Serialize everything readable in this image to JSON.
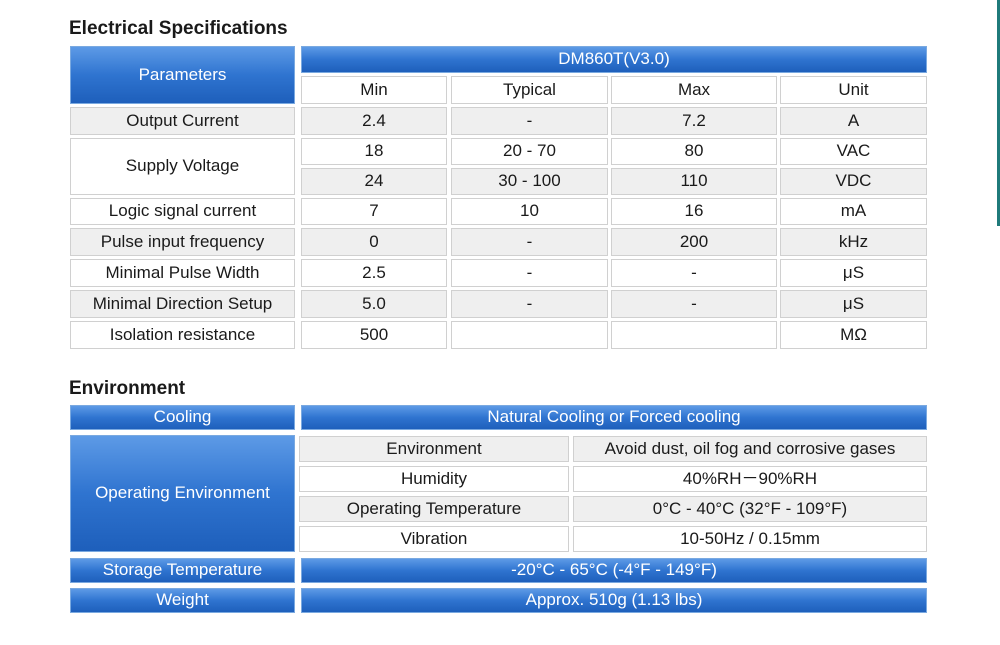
{
  "electrical": {
    "title": "Electrical Specifications",
    "param_header": "Parameters",
    "model": "DM860T(V3.0)",
    "columns": [
      "Min",
      "Typical",
      "Max",
      "Unit"
    ],
    "rows": [
      {
        "label": "Output Current",
        "min": "2.4",
        "typ": "-",
        "max": "7.2",
        "unit": "A"
      },
      {
        "label": "Supply Voltage",
        "min": "18",
        "typ": "20 - 70",
        "max": "80",
        "unit": "VAC"
      },
      {
        "label": "",
        "min": "24",
        "typ": "30 - 100",
        "max": "110",
        "unit": "VDC"
      },
      {
        "label": "Logic signal current",
        "min": "7",
        "typ": "10",
        "max": "16",
        "unit": "mA"
      },
      {
        "label": "Pulse input frequency",
        "min": "0",
        "typ": "-",
        "max": "200",
        "unit": "kHz"
      },
      {
        "label": "Minimal Pulse Width",
        "min": "2.5",
        "typ": "-",
        "max": "-",
        "unit": "μS"
      },
      {
        "label": "Minimal Direction Setup",
        "min": "5.0",
        "typ": "-",
        "max": "-",
        "unit": "μS"
      },
      {
        "label": "Isolation resistance",
        "min": "500",
        "typ": "",
        "max": "",
        "unit": "MΩ"
      }
    ]
  },
  "environment": {
    "title": "Environment",
    "cooling_label": "Cooling",
    "cooling_value": "Natural Cooling or Forced cooling",
    "operating_label": "Operating Environment",
    "operating": [
      {
        "label": "Environment",
        "value": "Avoid dust, oil fog and corrosive gases"
      },
      {
        "label": "Humidity",
        "value": "40%RH－90%RH"
      },
      {
        "label": "Operating Temperature",
        "value": "0°C - 40°C (32°F - 109°F)"
      },
      {
        "label": "Vibration",
        "value": "10-50Hz / 0.15mm"
      }
    ],
    "storage_label": "Storage Temperature",
    "storage_value": "-20°C - 65°C (-4°F - 149°F)",
    "weight_label": "Weight",
    "weight_value": "Approx. 510g (1.13 lbs)"
  }
}
